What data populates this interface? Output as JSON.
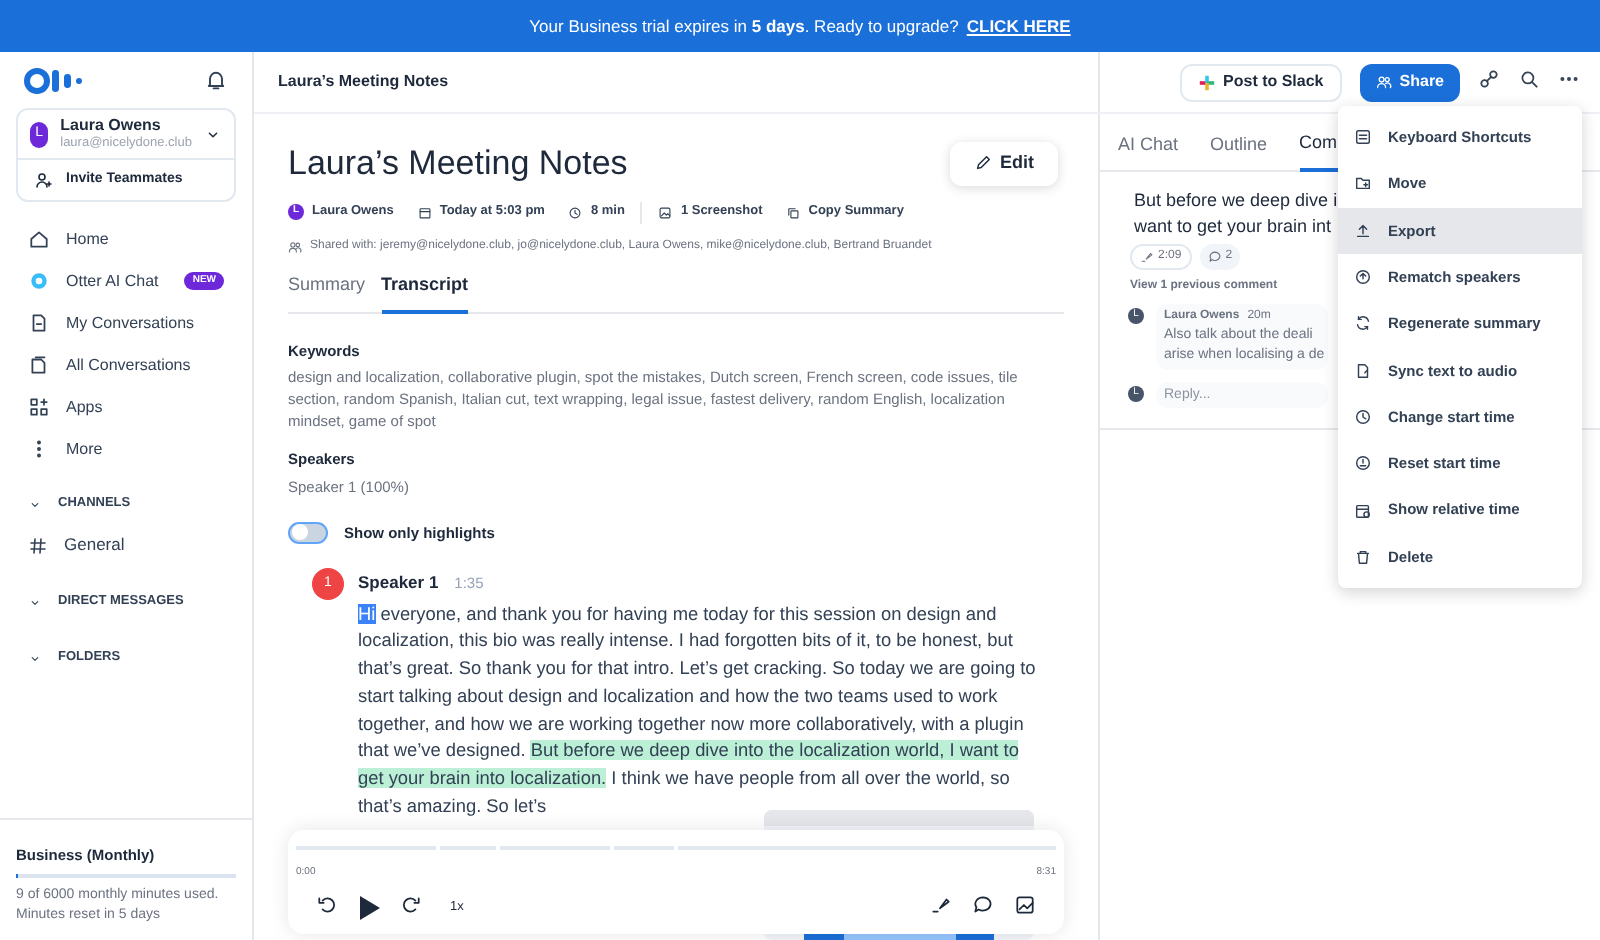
{
  "banner": {
    "text": "Your Business trial expires in **5 days**. Ready to upgrade?",
    "link": "CLICK HERE"
  },
  "sidebar": {
    "account": {
      "initial": "L",
      "name": "Laura Owens",
      "email": "laura@nicelydone.club"
    },
    "invite": "Invite Teammates",
    "items": [
      {
        "label": "Home",
        "selected": false
      },
      {
        "label": "Otter AI Chat",
        "badge": "NEW",
        "selected": false
      },
      {
        "label": "My Conversations",
        "selected": false
      },
      {
        "label": "All Conversations",
        "selected": false
      },
      {
        "label": "Apps",
        "selected": false
      },
      {
        "label": "More",
        "selected": false
      }
    ],
    "sections": [
      {
        "label": "CHANNELS",
        "children": [
          {
            "label": "General"
          }
        ]
      },
      {
        "label": "DIRECT MESSAGES"
      },
      {
        "label": "FOLDERS"
      }
    ],
    "plan": {
      "title": "Business (Monthly)",
      "level": 0.0015,
      "text": "9 of 6000 monthly minutes used. Minutes reset in 5 days"
    }
  },
  "header": {
    "title": "Laura’s Meeting Notes",
    "slack": "Post to Slack",
    "share": "Share"
  },
  "note": {
    "title": "Laura’s Meeting Notes",
    "edit": "Edit",
    "author_initial": "L",
    "author": "Laura Owens",
    "date": "Today at 5:03 pm",
    "duration": "8 min",
    "screenshots": "1 Screenshot",
    "copy": "Copy Summary",
    "shared": "Shared with: jeremy@nicelydone.club, jo@nicelydone.club, Laura Owens, mike@nicelydone.club, Bertrand Bruandet",
    "tabs": [
      {
        "label": "Summary",
        "selected": false
      },
      {
        "label": "Transcript",
        "selected": true
      }
    ],
    "keywords_title": "Keywords",
    "keywords": "design and localization, collaborative plugin, spot the mistakes, Dutch screen, French screen, code issues, tile section, random Spanish, Italian cut, text wrapping, legal issue, fastest delivery, random English, localization mindset, game of spot",
    "speakers_title": "Speakers",
    "speakers": "Speaker 1 (100%)",
    "highlights_toggle": {
      "label": "Show only highlights",
      "on": false
    },
    "transcript": {
      "number": "1",
      "speaker": "Speaker 1",
      "time": "1:35",
      "segments": [
        {
          "kind": "selected",
          "text": "Hi"
        },
        {
          "kind": "plain",
          "text": " everyone, and thank you for having me today for this session on design and localization, this bio was really intense. I had forgotten bits of it, to be honest, but that’s great. So thank you for that intro. Let’s get cracking. So today we are going to start talking about design and localization and how the two teams used to work together, and how we are working together now more collaboratively, with a plugin that we’ve designed. "
        },
        {
          "kind": "highlight",
          "text": "But before we deep dive into the localization world, I want to get your brain into localization."
        },
        {
          "kind": "plain",
          "text": " I think we have people from all over the world, so that’s amazing. So let’s"
        }
      ]
    },
    "player": {
      "start": "0:00",
      "end": "8:31",
      "speed": "1x"
    }
  },
  "panel": {
    "tabs": [
      {
        "label": "AI Chat",
        "selected": false
      },
      {
        "label": "Outline",
        "selected": false
      },
      {
        "label": "Com",
        "selected": true
      }
    ],
    "quote": [
      "But before we deep dive i",
      "want to get your brain int"
    ],
    "clip_time": "2:09",
    "comment_count": "2",
    "view_previous": "View 1 previous comment",
    "comment": {
      "initial": "L",
      "author": "Laura Owens",
      "age": "20m",
      "lines": [
        "Also talk about the deali",
        "arise when localising a de"
      ]
    },
    "reply": {
      "initial": "L",
      "placeholder": "Reply..."
    }
  },
  "menu": [
    {
      "label": "Keyboard Shortcuts",
      "selected": false
    },
    {
      "label": "Move",
      "selected": false
    },
    {
      "label": "Export",
      "selected": true
    },
    {
      "label": "Rematch speakers",
      "selected": false
    },
    {
      "label": "Regenerate summary",
      "selected": false
    },
    {
      "label": "Sync text to audio",
      "selected": false
    },
    {
      "label": "Change start time",
      "selected": false
    },
    {
      "label": "Reset start time",
      "selected": false
    },
    {
      "label": "Show relative time",
      "selected": false
    },
    {
      "label": "Delete",
      "selected": false
    }
  ]
}
